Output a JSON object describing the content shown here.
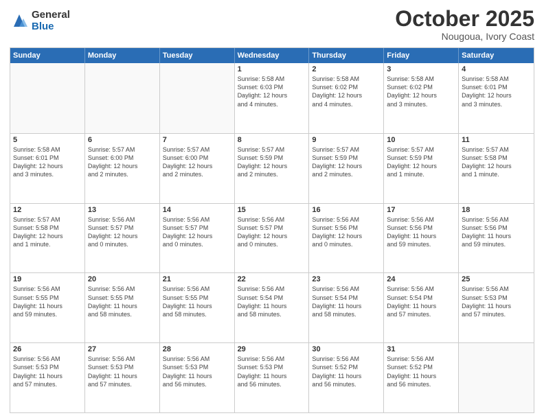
{
  "logo": {
    "general": "General",
    "blue": "Blue"
  },
  "header": {
    "month": "October 2025",
    "location": "Nougoua, Ivory Coast"
  },
  "days_of_week": [
    "Sunday",
    "Monday",
    "Tuesday",
    "Wednesday",
    "Thursday",
    "Friday",
    "Saturday"
  ],
  "weeks": [
    [
      {
        "num": "",
        "info": ""
      },
      {
        "num": "",
        "info": ""
      },
      {
        "num": "",
        "info": ""
      },
      {
        "num": "1",
        "info": "Sunrise: 5:58 AM\nSunset: 6:03 PM\nDaylight: 12 hours\nand 4 minutes."
      },
      {
        "num": "2",
        "info": "Sunrise: 5:58 AM\nSunset: 6:02 PM\nDaylight: 12 hours\nand 4 minutes."
      },
      {
        "num": "3",
        "info": "Sunrise: 5:58 AM\nSunset: 6:02 PM\nDaylight: 12 hours\nand 3 minutes."
      },
      {
        "num": "4",
        "info": "Sunrise: 5:58 AM\nSunset: 6:01 PM\nDaylight: 12 hours\nand 3 minutes."
      }
    ],
    [
      {
        "num": "5",
        "info": "Sunrise: 5:58 AM\nSunset: 6:01 PM\nDaylight: 12 hours\nand 3 minutes."
      },
      {
        "num": "6",
        "info": "Sunrise: 5:57 AM\nSunset: 6:00 PM\nDaylight: 12 hours\nand 2 minutes."
      },
      {
        "num": "7",
        "info": "Sunrise: 5:57 AM\nSunset: 6:00 PM\nDaylight: 12 hours\nand 2 minutes."
      },
      {
        "num": "8",
        "info": "Sunrise: 5:57 AM\nSunset: 5:59 PM\nDaylight: 12 hours\nand 2 minutes."
      },
      {
        "num": "9",
        "info": "Sunrise: 5:57 AM\nSunset: 5:59 PM\nDaylight: 12 hours\nand 2 minutes."
      },
      {
        "num": "10",
        "info": "Sunrise: 5:57 AM\nSunset: 5:59 PM\nDaylight: 12 hours\nand 1 minute."
      },
      {
        "num": "11",
        "info": "Sunrise: 5:57 AM\nSunset: 5:58 PM\nDaylight: 12 hours\nand 1 minute."
      }
    ],
    [
      {
        "num": "12",
        "info": "Sunrise: 5:57 AM\nSunset: 5:58 PM\nDaylight: 12 hours\nand 1 minute."
      },
      {
        "num": "13",
        "info": "Sunrise: 5:56 AM\nSunset: 5:57 PM\nDaylight: 12 hours\nand 0 minutes."
      },
      {
        "num": "14",
        "info": "Sunrise: 5:56 AM\nSunset: 5:57 PM\nDaylight: 12 hours\nand 0 minutes."
      },
      {
        "num": "15",
        "info": "Sunrise: 5:56 AM\nSunset: 5:57 PM\nDaylight: 12 hours\nand 0 minutes."
      },
      {
        "num": "16",
        "info": "Sunrise: 5:56 AM\nSunset: 5:56 PM\nDaylight: 12 hours\nand 0 minutes."
      },
      {
        "num": "17",
        "info": "Sunrise: 5:56 AM\nSunset: 5:56 PM\nDaylight: 11 hours\nand 59 minutes."
      },
      {
        "num": "18",
        "info": "Sunrise: 5:56 AM\nSunset: 5:56 PM\nDaylight: 11 hours\nand 59 minutes."
      }
    ],
    [
      {
        "num": "19",
        "info": "Sunrise: 5:56 AM\nSunset: 5:55 PM\nDaylight: 11 hours\nand 59 minutes."
      },
      {
        "num": "20",
        "info": "Sunrise: 5:56 AM\nSunset: 5:55 PM\nDaylight: 11 hours\nand 58 minutes."
      },
      {
        "num": "21",
        "info": "Sunrise: 5:56 AM\nSunset: 5:55 PM\nDaylight: 11 hours\nand 58 minutes."
      },
      {
        "num": "22",
        "info": "Sunrise: 5:56 AM\nSunset: 5:54 PM\nDaylight: 11 hours\nand 58 minutes."
      },
      {
        "num": "23",
        "info": "Sunrise: 5:56 AM\nSunset: 5:54 PM\nDaylight: 11 hours\nand 58 minutes."
      },
      {
        "num": "24",
        "info": "Sunrise: 5:56 AM\nSunset: 5:54 PM\nDaylight: 11 hours\nand 57 minutes."
      },
      {
        "num": "25",
        "info": "Sunrise: 5:56 AM\nSunset: 5:53 PM\nDaylight: 11 hours\nand 57 minutes."
      }
    ],
    [
      {
        "num": "26",
        "info": "Sunrise: 5:56 AM\nSunset: 5:53 PM\nDaylight: 11 hours\nand 57 minutes."
      },
      {
        "num": "27",
        "info": "Sunrise: 5:56 AM\nSunset: 5:53 PM\nDaylight: 11 hours\nand 57 minutes."
      },
      {
        "num": "28",
        "info": "Sunrise: 5:56 AM\nSunset: 5:53 PM\nDaylight: 11 hours\nand 56 minutes."
      },
      {
        "num": "29",
        "info": "Sunrise: 5:56 AM\nSunset: 5:53 PM\nDaylight: 11 hours\nand 56 minutes."
      },
      {
        "num": "30",
        "info": "Sunrise: 5:56 AM\nSunset: 5:52 PM\nDaylight: 11 hours\nand 56 minutes."
      },
      {
        "num": "31",
        "info": "Sunrise: 5:56 AM\nSunset: 5:52 PM\nDaylight: 11 hours\nand 56 minutes."
      },
      {
        "num": "",
        "info": ""
      }
    ]
  ]
}
